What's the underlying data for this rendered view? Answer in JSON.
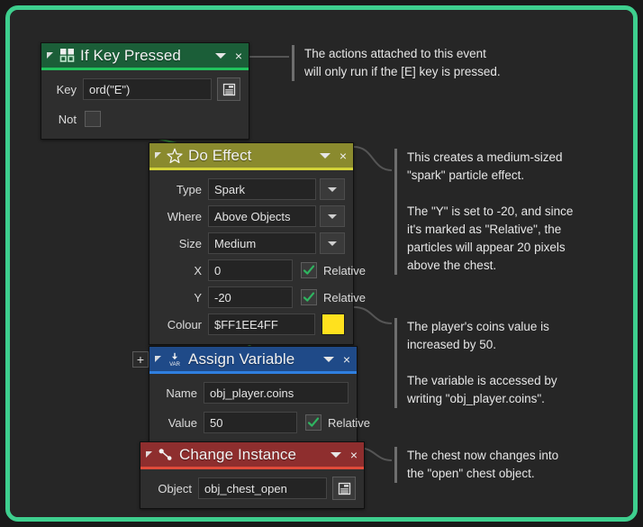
{
  "frame": {
    "border_color": "#3ecf8e",
    "background": "#262626"
  },
  "blocks": [
    {
      "id": "if-key-pressed",
      "title": "If Key Pressed",
      "icon": "grid-icon",
      "color": "#1b5e38",
      "accent": "#21c35d",
      "collapse_label": "◢",
      "caret_label": "▾",
      "close_label": "×",
      "fields": {
        "key_label": "Key",
        "key_value": "ord(\"E\")",
        "key_picker_icon": "list-picker-icon",
        "not_label": "Not",
        "not_checked": false
      }
    },
    {
      "id": "do-effect",
      "title": "Do Effect",
      "icon": "star-icon",
      "color": "#8a8a2e",
      "accent": "#d3d338",
      "caret_label": "▾",
      "close_label": "×",
      "fields": {
        "type_label": "Type",
        "type_value": "Spark",
        "where_label": "Where",
        "where_value": "Above Objects",
        "size_label": "Size",
        "size_value": "Medium",
        "x_label": "X",
        "x_value": "0",
        "x_relative_label": "Relative",
        "x_relative_checked": true,
        "y_label": "Y",
        "y_value": "-20",
        "y_relative_label": "Relative",
        "y_relative_checked": true,
        "colour_label": "Colour",
        "colour_value": "$FF1EE4FF",
        "colour_swatch": "#ffe11e"
      }
    },
    {
      "id": "assign-variable",
      "title": "Assign Variable",
      "icon": "var-arrow-icon",
      "color": "#1f4a88",
      "accent": "#2f7fe0",
      "caret_label": "▾",
      "close_label": "×",
      "add_button_label": "+",
      "fields": {
        "name_label": "Name",
        "name_value": "obj_player.coins",
        "value_label": "Value",
        "value_value": "50",
        "relative_label": "Relative",
        "relative_checked": true
      }
    },
    {
      "id": "change-instance",
      "title": "Change Instance",
      "icon": "instance-link-icon",
      "color": "#8e2e2e",
      "accent": "#e04b3a",
      "caret_label": "▾",
      "close_label": "×",
      "fields": {
        "object_label": "Object",
        "object_value": "obj_chest_open",
        "object_picker_icon": "list-picker-icon"
      }
    }
  ],
  "annotations": [
    {
      "id": "note-event",
      "text": "The actions attached to this event\nwill only run if the [E] key is pressed."
    },
    {
      "id": "note-effect",
      "text": "This creates a medium-sized\n\"spark\" particle effect.\n\nThe \"Y\" is set to -20, and since\nit's marked as \"Relative\", the\nparticles will appear 20 pixels\nabove the chest."
    },
    {
      "id": "note-variable",
      "text": "The player's coins value is\nincreased by 50.\n\nThe variable is accessed by\nwriting \"obj_player.coins\"."
    },
    {
      "id": "note-instance",
      "text": "The chest now changes into\nthe \"open\" chest object."
    }
  ]
}
